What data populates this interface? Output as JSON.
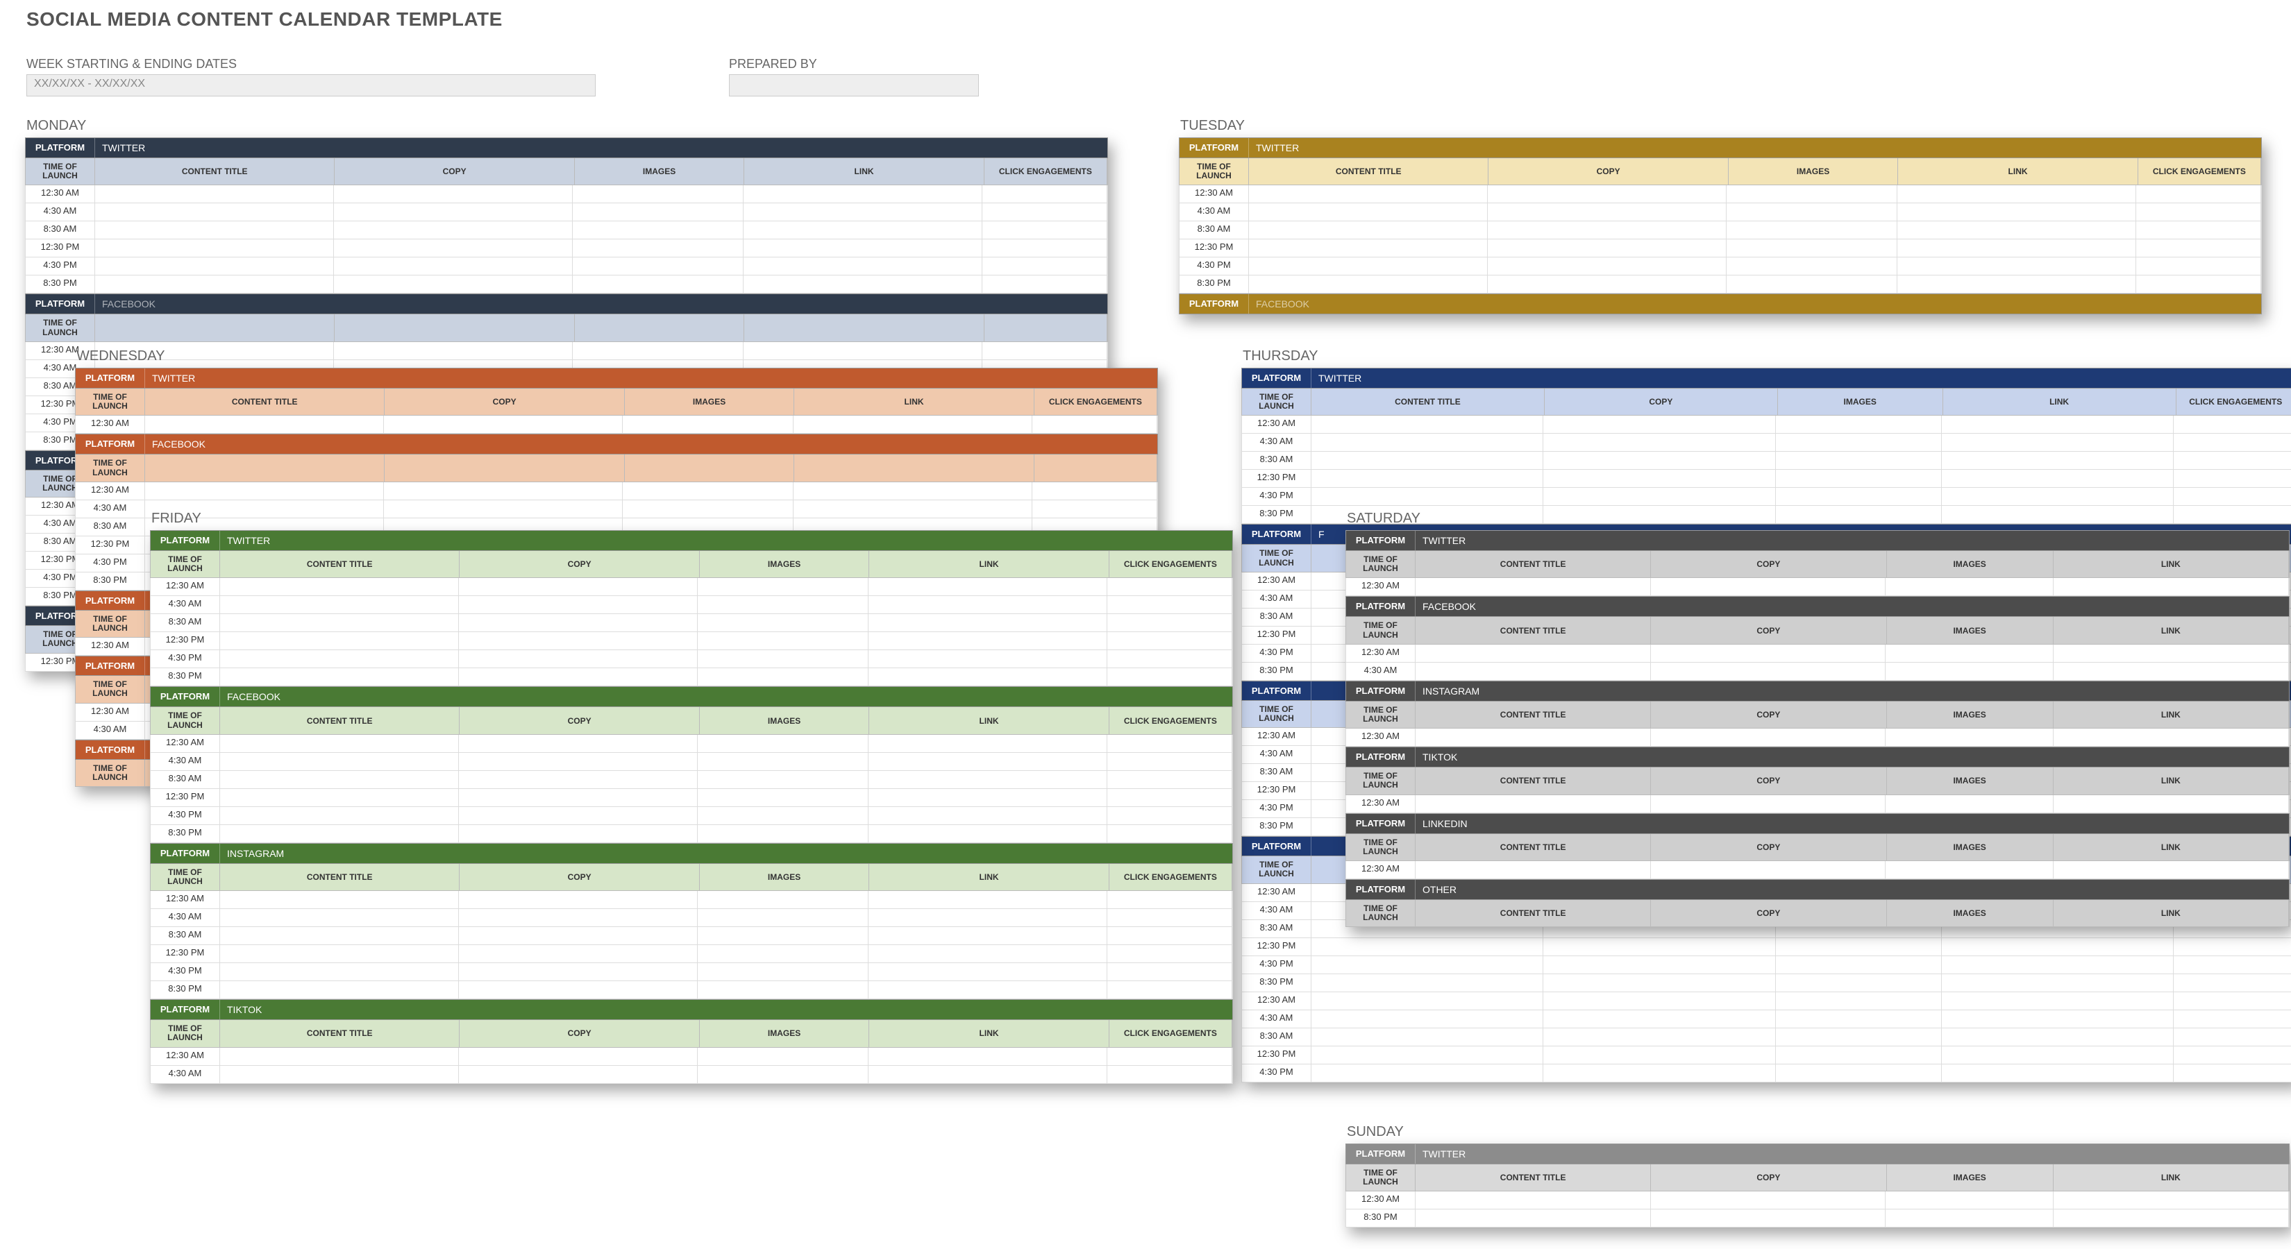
{
  "title": "SOCIAL MEDIA CONTENT CALENDAR TEMPLATE",
  "meta": {
    "week_label": "WEEK STARTING & ENDING DATES",
    "week_value": "XX/XX/XX - XX/XX/XX",
    "prepared_label": "PREPARED BY",
    "prepared_value": ""
  },
  "labels": {
    "platform": "PLATFORM",
    "time_of_launch": "TIME OF LAUNCH",
    "content_title": "CONTENT TITLE",
    "copy": "COPY",
    "images": "IMAGES",
    "link": "LINK",
    "click_engagements": "CLICK ENGAGEMENTS"
  },
  "platforms": {
    "twitter": "TWITTER",
    "facebook": "FACEBOOK",
    "instagram": "INSTAGRAM",
    "tiktok": "TIKTOK",
    "linkedin": "LINKEDIN",
    "other": "OTHER"
  },
  "days": {
    "monday": "MONDAY",
    "tuesday": "TUESDAY",
    "wednesday": "WEDNESDAY",
    "thursday": "THURSDAY",
    "friday": "FRIDAY",
    "saturday": "SATURDAY",
    "sunday": "SUNDAY"
  },
  "times6": [
    "12:30 AM",
    "4:30 AM",
    "8:30 AM",
    "12:30 PM",
    "4:30 PM",
    "8:30 PM"
  ],
  "times1": [
    "12:30 AM"
  ],
  "times2": [
    "12:30 AM",
    "4:30 AM"
  ],
  "thu_extra": [
    "12:30 AM",
    "4:30 AM",
    "8:30 AM",
    "12:30 PM",
    "4:30 PM",
    "8:30 PM",
    "12:30 AM",
    "4:30 AM",
    "8:30 AM",
    "12:30 PM",
    "4:30 PM"
  ]
}
